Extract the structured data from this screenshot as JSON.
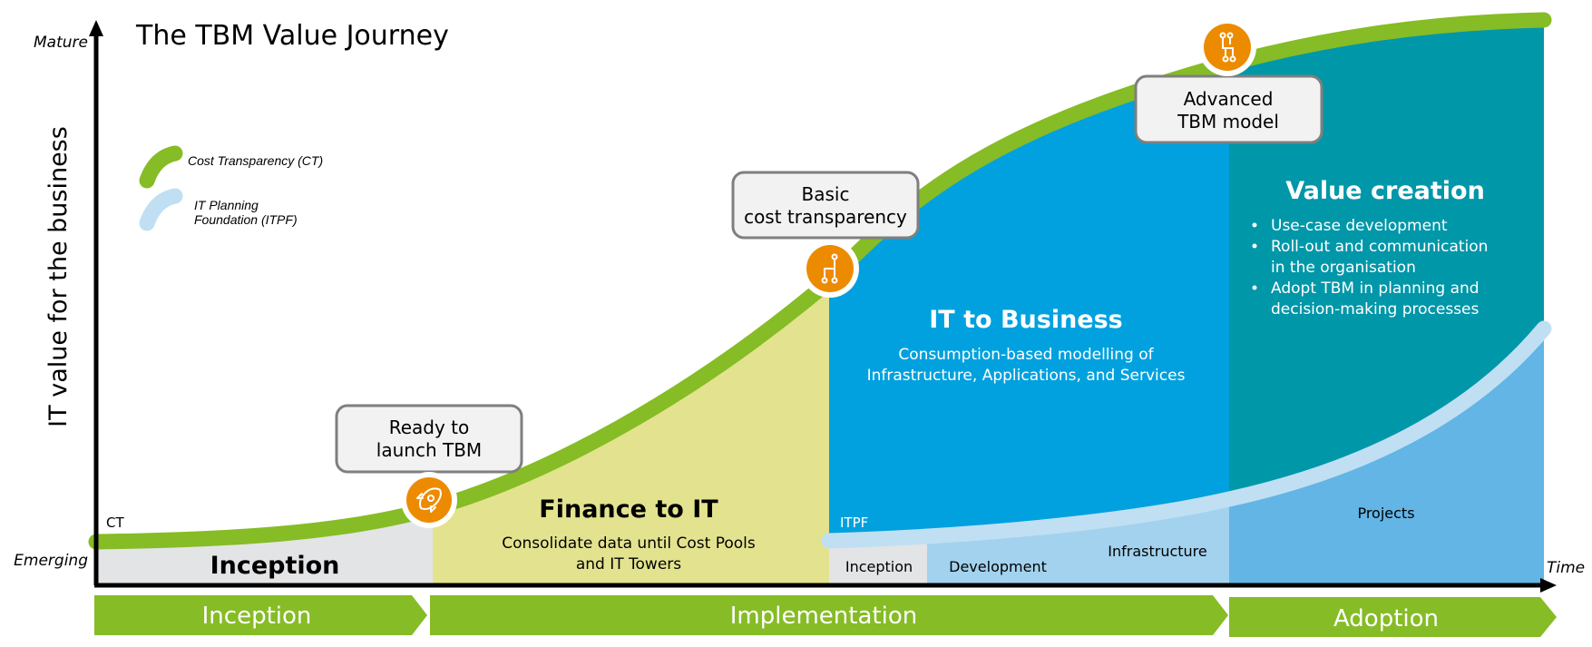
{
  "title": "The TBM Value Journey",
  "axes": {
    "y_label": "IT value for the business",
    "y_top": "Mature",
    "y_bottom": "Emerging",
    "x_end": "Time"
  },
  "legend": {
    "ct": "Cost Transparency (CT)",
    "itpf_line1": "IT Planning",
    "itpf_line2": "Foundation (ITPF)"
  },
  "curve_labels": {
    "ct": "CT",
    "itpf": "ITPF"
  },
  "regions": {
    "inception": {
      "title": "Inception"
    },
    "finance": {
      "title": "Finance to IT",
      "desc_line1": "Consolidate data until Cost Pools",
      "desc_line2": "and IT Towers"
    },
    "it_business": {
      "title": "IT to Business",
      "desc_line1": "Consumption-based modelling of",
      "desc_line2": "Infrastructure, Applications, and Services"
    },
    "value": {
      "title": "Value creation",
      "bullets": [
        [
          "Use-case development"
        ],
        [
          "Roll-out and communication",
          "in the organisation"
        ],
        [
          "Adopt TBM in planning and",
          "decision-making processes"
        ]
      ]
    }
  },
  "itpf_sub": {
    "inception": "Inception",
    "development": "Development",
    "infrastructure": "Infrastructure",
    "projects": "Projects"
  },
  "milestones": {
    "ready": {
      "line1": "Ready to",
      "line2": "launch TBM",
      "icon": "rocket-icon"
    },
    "basic": {
      "line1": "Basic",
      "line2": "cost transparency",
      "icon": "circuit-icon"
    },
    "advanced": {
      "line1": "Advanced",
      "line2": "TBM model",
      "icon": "circuit-branch-icon"
    }
  },
  "phases": [
    "Inception",
    "Implementation",
    "Adoption"
  ],
  "colors": {
    "ct_green": "#86bc25",
    "itpf_light": "#c0dff3",
    "inception_gray": "#e3e4e6",
    "finance_yellow": "#e3e38f",
    "it_blue": "#00a1de",
    "value_teal": "#0097a9",
    "itpf_sub_light": "#a3d2ee",
    "projects_blue": "#62b5e5",
    "milestone_orange": "#ed8b00",
    "box_fill": "#f2f2f2",
    "box_stroke": "#7f7f7f"
  }
}
